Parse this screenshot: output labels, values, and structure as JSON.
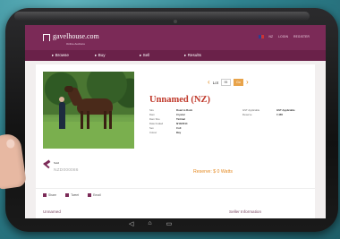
{
  "header": {
    "logo_text": "gavelhouse.com",
    "logo_sub": "Online Auctions",
    "top_links": [
      "NZ",
      "LOGIN",
      "REGISTER"
    ]
  },
  "nav": {
    "items": [
      {
        "label": "Browse"
      },
      {
        "label": "Buy"
      },
      {
        "label": "Sell"
      },
      {
        "label": "Results"
      }
    ]
  },
  "lot": {
    "label": "Lot",
    "number": "95",
    "go": "Go"
  },
  "listing": {
    "name": "Unnamed (NZ)",
    "specs_left": [
      {
        "k": "Sire",
        "v": "Road to Rock"
      },
      {
        "k": "Dam",
        "v": "Crystal"
      },
      {
        "k": "Dam Sire",
        "v": "Tintinal"
      },
      {
        "k": "Date Foaled",
        "v": "8/10/2014"
      },
      {
        "k": "Sex",
        "v": "Colt"
      },
      {
        "k": "Colour",
        "v": "Bay"
      }
    ],
    "specs_right": [
      {
        "k": "GST Applicable",
        "v": "GST Applicable"
      },
      {
        "k": "Reserve",
        "v": "7,465"
      }
    ],
    "reserve_text": "Reserve: $ 0 Watts",
    "sold_label": "Sold",
    "buyer_id": "NZD000086"
  },
  "share": {
    "buttons": [
      "Share",
      "Tweet",
      "Email"
    ]
  },
  "sections": {
    "left": "Unnamed",
    "right": "Seller Information"
  },
  "colors": {
    "brand": "#7b2a57",
    "accent": "#e58a22",
    "name": "#c0392b"
  }
}
